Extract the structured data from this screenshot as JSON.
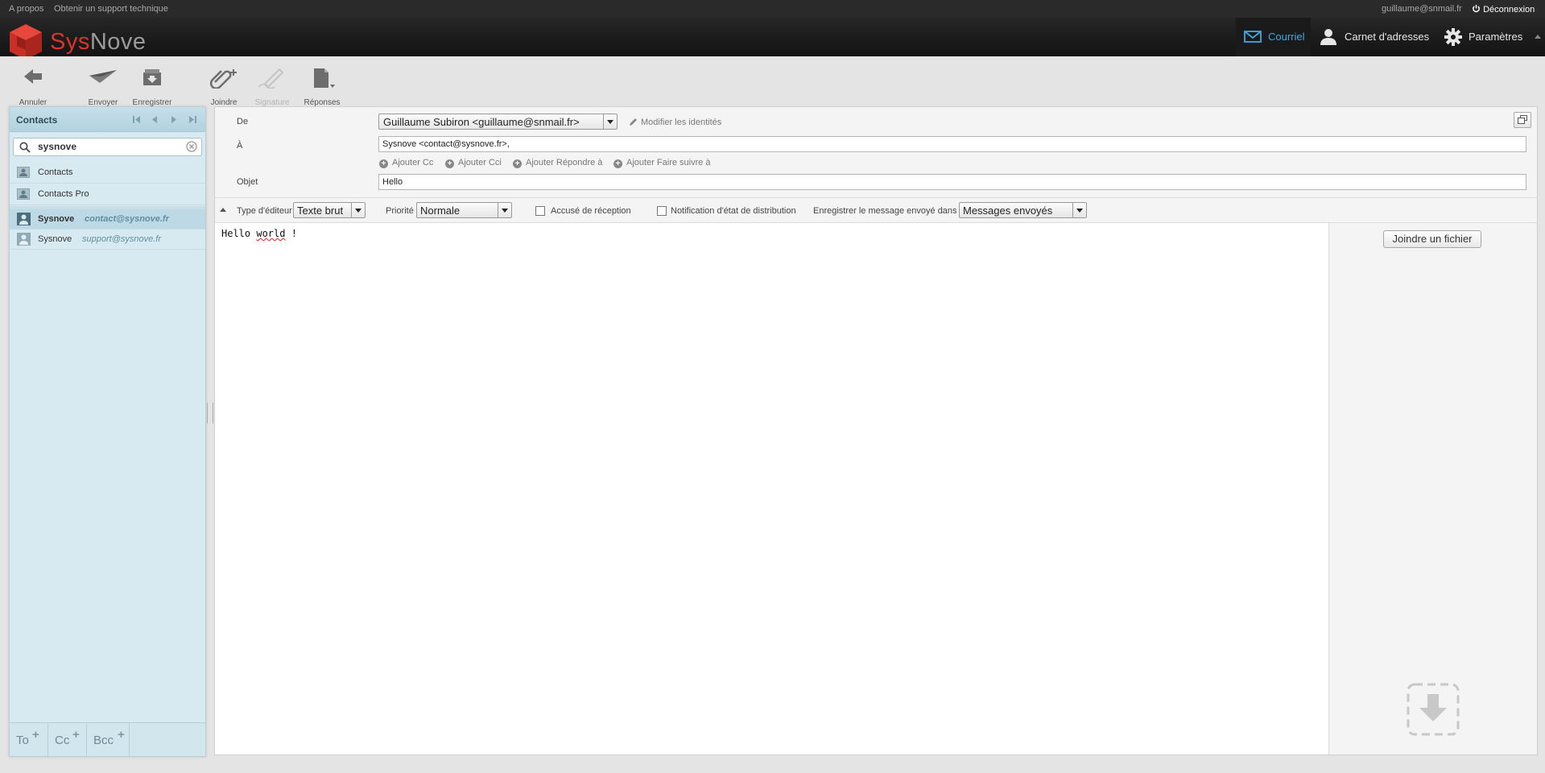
{
  "topline": {
    "about": "A propos",
    "support": "Obtenir un support technique",
    "user_email": "guillaume@snmail.fr",
    "logout": "Déconnexion"
  },
  "brand": {
    "part1": "Sys",
    "part2": "Nove"
  },
  "nav": {
    "mail": "Courriel",
    "addressbook": "Carnet d'adresses",
    "settings": "Paramètres"
  },
  "toolbar": {
    "cancel": "Annuler",
    "send": "Envoyer",
    "save": "Enregistrer",
    "attach": "Joindre",
    "signature": "Signature",
    "responses": "Réponses"
  },
  "contacts": {
    "title": "Contacts",
    "search_value": "sysnove",
    "addressbooks": [
      "Contacts",
      "Contacts Pro"
    ],
    "results": [
      {
        "name": "Sysnove",
        "email": "contact@sysnove.fr",
        "selected": true
      },
      {
        "name": "Sysnove",
        "email": "support@sysnove.fr",
        "selected": false
      }
    ],
    "recipient_buttons": [
      "To",
      "Cc",
      "Bcc"
    ]
  },
  "compose": {
    "from_label": "De",
    "from_value": "Guillaume Subiron <guillaume@snmail.fr>",
    "edit_identities": "Modifier les identités",
    "to_label": "À",
    "to_value": "Sysnove <contact@sysnove.fr>,",
    "add_cc": "Ajouter Cc",
    "add_bcc": "Ajouter Cci",
    "add_reply_to": "Ajouter Répondre à",
    "add_followup": "Ajouter Faire suivre à",
    "subject_label": "Objet",
    "subject_value": "Hello",
    "editor_type_label": "Type d'éditeur",
    "editor_type_value": "Texte brut",
    "priority_label": "Priorité",
    "priority_value": "Normale",
    "receipt_label": "Accusé de réception",
    "dsn_label": "Notification d'état de distribution",
    "save_in_label": "Enregistrer le message envoyé dans",
    "save_in_value": "Messages envoyés",
    "body_text_before": "Hello ",
    "body_text_misspelled": "world",
    "body_text_after": " !",
    "attach_file": "Joindre un fichier"
  },
  "colors": {
    "accent": "#3ea9e6",
    "brand_red": "#d9362b",
    "panel_blue": "#d8eaf1"
  },
  "icons": [
    "power-icon",
    "envelope-icon",
    "person-icon",
    "gear-icon",
    "back-arrow-icon",
    "paper-plane-icon",
    "save-box-icon",
    "paperclip-icon",
    "pen-icon",
    "document-icon",
    "search-icon",
    "clear-icon",
    "addressbook-icon",
    "contact-icon",
    "restore-icon",
    "drop-icon"
  ]
}
